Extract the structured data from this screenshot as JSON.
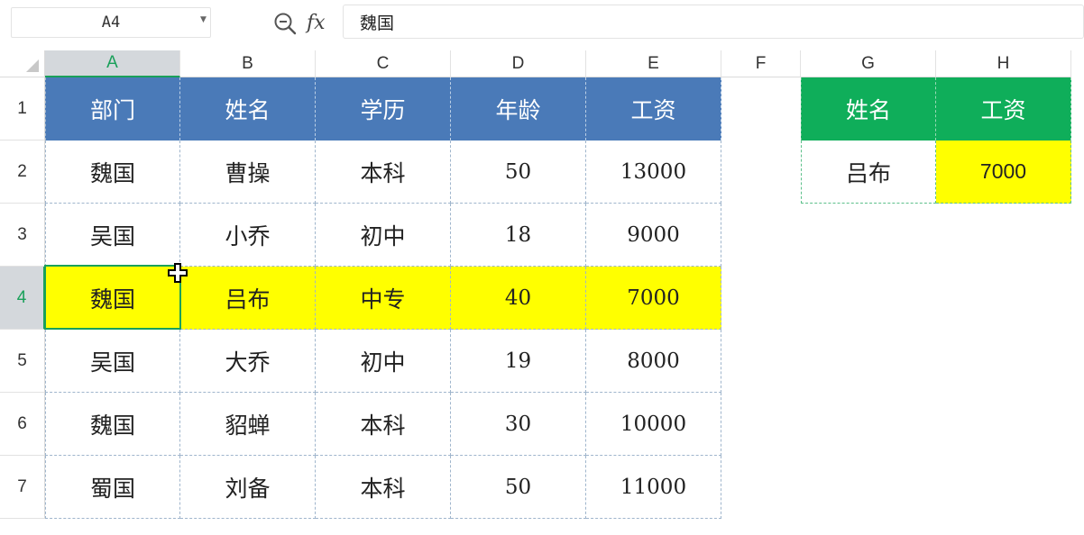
{
  "formula_bar": {
    "name_box": "A4",
    "fx_label": "fx",
    "formula_value": "魏国",
    "zoom_icon": "zoom-out-icon"
  },
  "columns": [
    "A",
    "B",
    "C",
    "D",
    "E",
    "F",
    "G",
    "H"
  ],
  "active_column": "A",
  "rows": [
    "1",
    "2",
    "3",
    "4",
    "5",
    "6",
    "7"
  ],
  "active_row": "4",
  "main_table": {
    "headers": [
      "部门",
      "姓名",
      "学历",
      "年龄",
      "工资"
    ],
    "rows": [
      [
        "魏国",
        "曹操",
        "本科",
        "50",
        "13000"
      ],
      [
        "吴国",
        "小乔",
        "初中",
        "18",
        "9000"
      ],
      [
        "魏国",
        "吕布",
        "中专",
        "40",
        "7000"
      ],
      [
        "吴国",
        "大乔",
        "初中",
        "19",
        "8000"
      ],
      [
        "魏国",
        "貂蝉",
        "本科",
        "30",
        "10000"
      ],
      [
        "蜀国",
        "刘备",
        "本科",
        "50",
        "11000"
      ]
    ],
    "header_color": "#4a7ab8",
    "highlight_color": "#ffff00",
    "highlight_row_index": 2
  },
  "lookup_table": {
    "headers": [
      "姓名",
      "工资"
    ],
    "row": [
      "吕布",
      "7000"
    ],
    "header_color": "#0fae5a",
    "result_color": "#ffff00"
  },
  "cursor_icon": "cell-select-cross-cursor-icon"
}
